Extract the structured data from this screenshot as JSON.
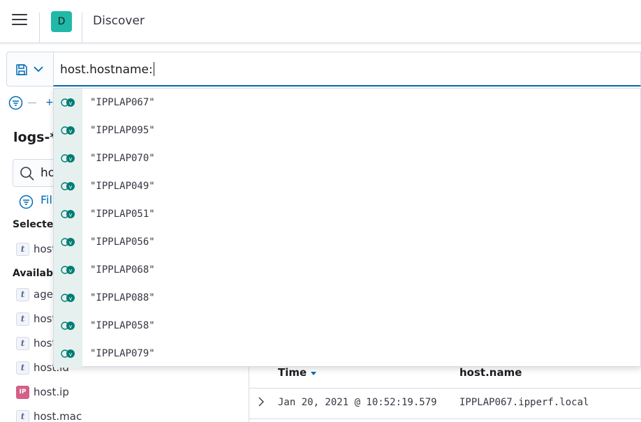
{
  "header": {
    "space_initial": "D",
    "title": "Discover"
  },
  "query": {
    "value": "host.hostname:"
  },
  "filter_row": {
    "add_label": "+"
  },
  "sidebar": {
    "index_pattern": "logs-*",
    "search_value": "ho",
    "filter_label": "Fil",
    "selected_label": "Selecte",
    "selected_fields": [
      {
        "type": "t",
        "name": "host"
      }
    ],
    "available_label": "Availabl",
    "available_fields": [
      {
        "type": "t",
        "name": "agen"
      },
      {
        "type": "t",
        "name": "host"
      },
      {
        "type": "t",
        "name": "host"
      },
      {
        "type": "t",
        "name": "host.id"
      },
      {
        "type": "IP",
        "name": "host.ip"
      },
      {
        "type": "t",
        "name": "host.mac"
      }
    ]
  },
  "suggestions": [
    "\"IPPLAP067\"",
    "\"IPPLAP095\"",
    "\"IPPLAP070\"",
    "\"IPPLAP049\"",
    "\"IPPLAP051\"",
    "\"IPPLAP056\"",
    "\"IPPLAP068\"",
    "\"IPPLAP088\"",
    "\"IPPLAP058\"",
    "\"IPPLAP079\""
  ],
  "table": {
    "columns": [
      "Time",
      "host.name"
    ],
    "rows": [
      {
        "time": "Jan 20, 2021 @ 10:52:19.579",
        "host_name": "IPPLAP067.ipperf.local"
      }
    ]
  },
  "colors": {
    "accent": "#006bb4",
    "suggestion_icon": "#017d73",
    "space_avatar": "#20b9a8"
  }
}
